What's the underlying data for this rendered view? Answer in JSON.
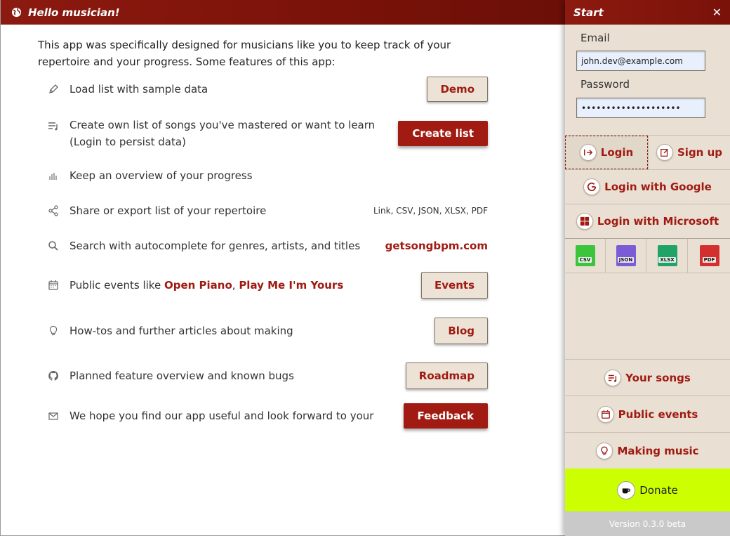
{
  "main": {
    "title": "Hello musician!",
    "intro": "This app was specifically designed for musicians like you to keep track of your repertoire and your progress. Some features of this app:",
    "features": [
      {
        "icon": "pencil-icon",
        "text": "Load list with sample data",
        "button": "Demo"
      },
      {
        "icon": "playlist-icon",
        "text": "Create own list of songs you've mastered or want to learn (Login to persist data)",
        "button": "Create list"
      },
      {
        "icon": "bar-chart-icon",
        "text": "Keep an overview of your progress"
      },
      {
        "icon": "share-icon",
        "text": "Share or export list of your repertoire",
        "right_text": "Link, CSV, JSON, XLSX, PDF"
      },
      {
        "icon": "search-icon",
        "text": "Search with autocomplete for genres, artists, and titles",
        "right_link": "getsongbpm.com"
      },
      {
        "icon": "calendar-icon",
        "text_prefix": "Public events like ",
        "link1": "Open Piano",
        "sep": ", ",
        "link2": "Play Me I'm Yours",
        "button": "Events"
      },
      {
        "icon": "lightbulb-icon",
        "text": "How-tos and further articles about making",
        "button": "Blog"
      },
      {
        "icon": "github-icon",
        "text": "Planned feature overview and known bugs",
        "button": "Roadmap"
      },
      {
        "icon": "mail-icon",
        "text": "We hope you find our app useful and look forward to your",
        "button": "Feedback"
      }
    ]
  },
  "sidebar": {
    "title": "Start",
    "close": "✕",
    "email_label": "Email",
    "email_value": "john.dev@example.com",
    "password_label": "Password",
    "password_value": "••••••••••••••••••••",
    "login": "Login",
    "signup": "Sign up",
    "login_google": "Login with Google",
    "login_microsoft": "Login with Microsoft",
    "file_formats": [
      "CSV",
      "JSON",
      "XLSX",
      "PDF"
    ],
    "your_songs": "Your songs",
    "public_events": "Public events",
    "making_music": "Making music",
    "donate": "Donate",
    "version": "Version 0.3.0 beta"
  },
  "colors": {
    "header": "#7a1209",
    "accent": "#a01a12",
    "sidebar_bg": "#e9e0d3",
    "donate_bg": "#ccff00",
    "csv": "#3cc43c",
    "json": "#7b5bd6",
    "xlsx": "#21a366",
    "pdf": "#d32f2f"
  }
}
